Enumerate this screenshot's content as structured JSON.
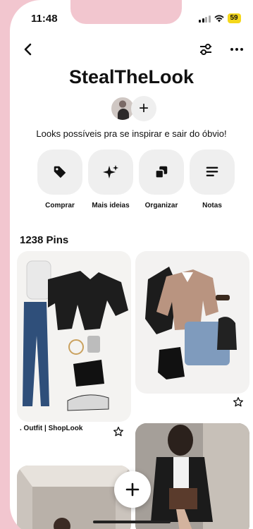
{
  "status_bar": {
    "time": "11:48",
    "battery": "59"
  },
  "board": {
    "title": "StealTheLook",
    "description": "Looks possíveis pra se inspirar e sair do óbvio!"
  },
  "actions": [
    {
      "label": "Comprar",
      "icon": "tag-icon"
    },
    {
      "label": "Mais ideias",
      "icon": "sparkle-icon"
    },
    {
      "label": "Organizar",
      "icon": "organize-icon"
    },
    {
      "label": "Notas",
      "icon": "notes-icon"
    }
  ],
  "pins": {
    "count_label": "1238 Pins",
    "first_caption": ". Outfit | ShopLook"
  },
  "colors": {
    "background": "#f2c6cf",
    "accent_battery": "#f4d71b",
    "action_bg": "#efefef"
  }
}
